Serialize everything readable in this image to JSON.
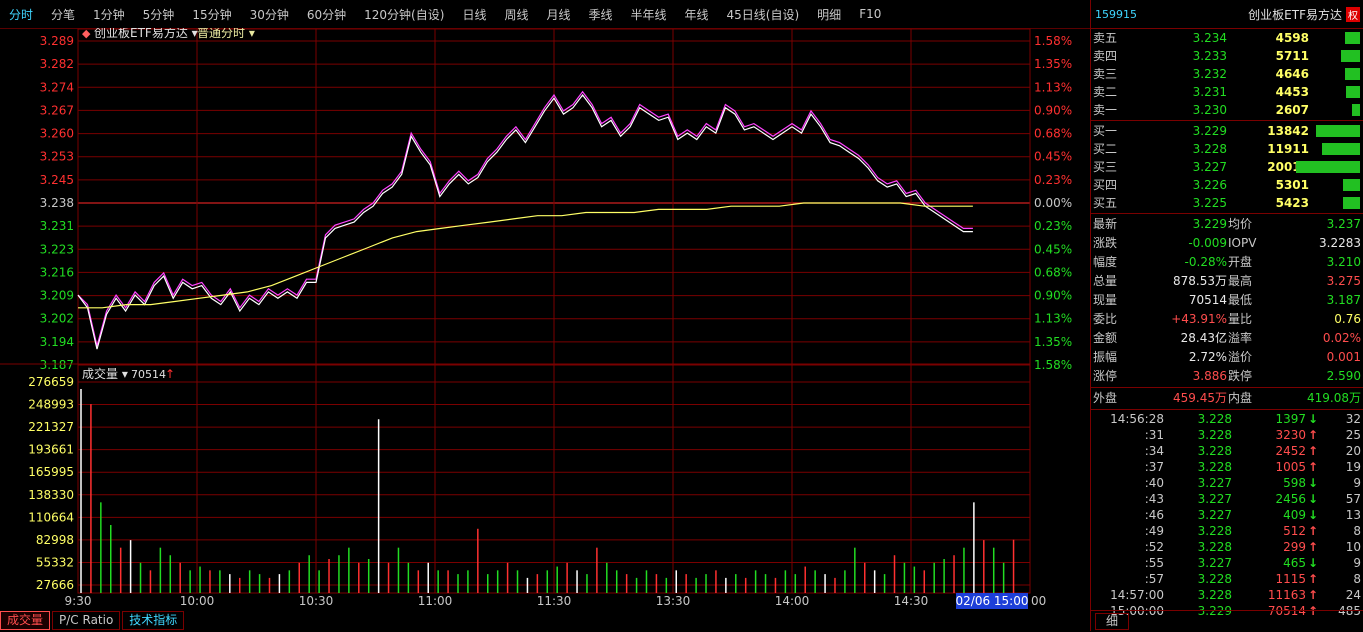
{
  "toolbar": {
    "tabs": [
      "分时",
      "分笔",
      "1分钟",
      "5分钟",
      "15分钟",
      "30分钟",
      "60分钟",
      "120分钟(自设)",
      "日线",
      "周线",
      "月线",
      "季线",
      "半年线",
      "年线",
      "45日线(自设)",
      "明细",
      "F10"
    ],
    "active_index": 0
  },
  "chart": {
    "stock_name": "创业板ETF易方达",
    "mode": "普通分时",
    "price_labels": [
      "3.289",
      "3.282",
      "3.274",
      "3.267",
      "3.260",
      "3.253",
      "3.245",
      "3.238",
      "3.231",
      "3.223",
      "3.216",
      "3.209",
      "3.202",
      "3.194",
      "3.187"
    ],
    "pct_labels": [
      "1.58%",
      "1.35%",
      "1.13%",
      "0.90%",
      "0.68%",
      "0.45%",
      "0.23%",
      "0.00%",
      "0.23%",
      "0.45%",
      "0.68%",
      "0.90%",
      "1.13%",
      "1.35%",
      "1.58%"
    ],
    "vol_title": "成交量",
    "vol_current": "70514",
    "vol_labels": [
      "276659",
      "248993",
      "221327",
      "193661",
      "165995",
      "138330",
      "110664",
      "82998",
      "55332",
      "27666"
    ],
    "time_labels": [
      "9:30",
      "10:00",
      "10:30",
      "11:00",
      "11:30",
      "13:30",
      "14:00",
      "14:30"
    ],
    "cursor_time": "02/06 15:00",
    "end_label": "00",
    "colors": {
      "price_line": "#ffffff",
      "etf_line": "#ff44ff",
      "avg_line": "#ffff66",
      "grid": "#7a0000",
      "up": "#ff3030",
      "down": "#22dd22"
    }
  },
  "chart_data": {
    "type": "line",
    "x_range": [
      "09:30",
      "15:00"
    ],
    "ylim": [
      3.187,
      3.289
    ],
    "prev_close": 3.238,
    "series": [
      {
        "values": [
          3.209,
          3.205,
          3.192,
          3.203,
          3.208,
          3.204,
          3.209,
          3.206,
          3.212,
          3.215,
          3.208,
          3.213,
          3.211,
          3.212,
          3.208,
          3.206,
          3.21,
          3.204,
          3.208,
          3.206,
          3.21,
          3.208,
          3.21,
          3.208,
          3.213,
          3.213,
          3.227,
          3.23,
          3.231,
          3.232,
          3.235,
          3.237,
          3.241,
          3.243,
          3.247,
          3.259,
          3.254,
          3.25,
          3.24,
          3.244,
          3.247,
          3.244,
          3.246,
          3.251,
          3.254,
          3.258,
          3.261,
          3.257,
          3.262,
          3.267,
          3.271,
          3.266,
          3.268,
          3.272,
          3.268,
          3.262,
          3.264,
          3.259,
          3.262,
          3.268,
          3.266,
          3.264,
          3.265,
          3.258,
          3.26,
          3.258,
          3.262,
          3.26,
          3.268,
          3.266,
          3.261,
          3.262,
          3.26,
          3.258,
          3.26,
          3.262,
          3.26,
          3.266,
          3.262,
          3.257,
          3.256,
          3.254,
          3.252,
          3.249,
          3.245,
          3.243,
          3.244,
          3.24,
          3.241,
          3.237,
          3.235,
          3.233,
          3.231,
          3.229,
          3.229
        ]
      },
      {
        "values": [
          3.209,
          3.206,
          3.193,
          3.204,
          3.209,
          3.205,
          3.21,
          3.207,
          3.213,
          3.216,
          3.209,
          3.214,
          3.212,
          3.213,
          3.209,
          3.207,
          3.211,
          3.205,
          3.209,
          3.207,
          3.211,
          3.209,
          3.211,
          3.209,
          3.214,
          3.214,
          3.228,
          3.231,
          3.232,
          3.233,
          3.236,
          3.238,
          3.242,
          3.244,
          3.248,
          3.26,
          3.255,
          3.251,
          3.241,
          3.245,
          3.248,
          3.245,
          3.247,
          3.252,
          3.255,
          3.259,
          3.262,
          3.258,
          3.263,
          3.268,
          3.272,
          3.267,
          3.269,
          3.273,
          3.269,
          3.263,
          3.265,
          3.26,
          3.263,
          3.269,
          3.267,
          3.265,
          3.266,
          3.259,
          3.261,
          3.259,
          3.263,
          3.261,
          3.269,
          3.267,
          3.262,
          3.263,
          3.261,
          3.259,
          3.261,
          3.263,
          3.261,
          3.267,
          3.263,
          3.258,
          3.257,
          3.255,
          3.253,
          3.25,
          3.246,
          3.244,
          3.245,
          3.241,
          3.242,
          3.238,
          3.236,
          3.234,
          3.232,
          3.23,
          3.23
        ]
      },
      {
        "values": [
          3.205,
          3.205,
          3.206,
          3.206,
          3.207,
          3.208,
          3.209,
          3.21,
          3.212,
          3.215,
          3.218,
          3.221,
          3.224,
          3.227,
          3.229,
          3.23,
          3.231,
          3.232,
          3.233,
          3.234,
          3.234,
          3.235,
          3.235,
          3.235,
          3.236,
          3.236,
          3.236,
          3.237,
          3.237,
          3.237,
          3.238,
          3.238,
          3.238,
          3.238,
          3.238,
          3.237,
          3.237,
          3.237
        ]
      }
    ],
    "volume": [
      270000,
      250000,
      120000,
      90000,
      60000,
      70000,
      40000,
      30000,
      60000,
      50000,
      40000,
      30000,
      35000,
      30000,
      30000,
      25000,
      20000,
      30000,
      25000,
      20000,
      25000,
      30000,
      40000,
      50000,
      30000,
      45000,
      50000,
      60000,
      40000,
      45000,
      230000,
      40000,
      60000,
      40000,
      30000,
      40000,
      30000,
      30000,
      25000,
      30000,
      85000,
      25000,
      30000,
      40000,
      30000,
      20000,
      25000,
      30000,
      35000,
      40000,
      30000,
      25000,
      60000,
      40000,
      30000,
      25000,
      20000,
      30000,
      25000,
      20000,
      30000,
      25000,
      20000,
      25000,
      30000,
      20000,
      25000,
      20000,
      30000,
      25000,
      20000,
      30000,
      25000,
      35000,
      30000,
      25000,
      20000,
      30000,
      60000,
      40000,
      30000,
      25000,
      50000,
      40000,
      35000,
      30000,
      40000,
      45000,
      50000,
      60000,
      120000,
      70000,
      60000,
      40000,
      70514
    ]
  },
  "panel": {
    "code": "159915",
    "name": "创业板ETF易方达",
    "quan": "权",
    "asks": [
      {
        "label": "卖五",
        "price": "3.234",
        "vol": "4598",
        "bar": 0.23
      },
      {
        "label": "卖四",
        "price": "3.233",
        "vol": "5711",
        "bar": 0.29
      },
      {
        "label": "卖三",
        "price": "3.232",
        "vol": "4646",
        "bar": 0.23
      },
      {
        "label": "卖二",
        "price": "3.231",
        "vol": "4453",
        "bar": 0.22
      },
      {
        "label": "卖一",
        "price": "3.230",
        "vol": "2607",
        "bar": 0.13
      }
    ],
    "bids": [
      {
        "label": "买一",
        "price": "3.229",
        "vol": "13842",
        "bar": 0.69
      },
      {
        "label": "买二",
        "price": "3.228",
        "vol": "11911",
        "bar": 0.6
      },
      {
        "label": "买三",
        "price": "3.227",
        "vol": "20011",
        "bar": 1.0
      },
      {
        "label": "买四",
        "price": "3.226",
        "vol": "5301",
        "bar": 0.26
      },
      {
        "label": "买五",
        "price": "3.225",
        "vol": "5423",
        "bar": 0.27
      }
    ],
    "stats": [
      {
        "l1": "最新",
        "v1": "3.229",
        "c1": "g",
        "l2": "均价",
        "v2": "3.237",
        "c2": "g"
      },
      {
        "l1": "涨跌",
        "v1": "-0.009",
        "c1": "g",
        "l2": "IOPV",
        "v2": "3.2283",
        "c2": "w"
      },
      {
        "l1": "幅度",
        "v1": "-0.28%",
        "c1": "g",
        "l2": "开盘",
        "v2": "3.210",
        "c2": "g"
      },
      {
        "l1": "总量",
        "v1": "878.53万",
        "c1": "w",
        "l2": "最高",
        "v2": "3.275",
        "c2": "r"
      },
      {
        "l1": "现量",
        "v1": "70514",
        "c1": "w",
        "l2": "最低",
        "v2": "3.187",
        "c2": "g"
      },
      {
        "l1": "委比",
        "v1": "+43.91%",
        "c1": "r",
        "l2": "量比",
        "v2": "0.76",
        "c2": "y"
      },
      {
        "l1": "金额",
        "v1": "28.43亿",
        "c1": "w",
        "l2": "溢率",
        "v2": "0.02%",
        "c2": "r"
      },
      {
        "l1": "振幅",
        "v1": "2.72%",
        "c1": "w",
        "l2": "溢价",
        "v2": "0.001",
        "c2": "r"
      },
      {
        "l1": "涨停",
        "v1": "3.886",
        "c1": "r",
        "l2": "跌停",
        "v2": "2.590",
        "c2": "g"
      }
    ],
    "outer_label": "外盘",
    "outer_value": "459.45万",
    "inner_label": "内盘",
    "inner_value": "419.08万",
    "ticks": [
      {
        "t": "14:56:28",
        "p": "3.228",
        "pc": "g",
        "v": "1397",
        "d": "down",
        "n": "32"
      },
      {
        "t": ":31",
        "p": "3.228",
        "pc": "g",
        "v": "3230",
        "d": "up",
        "n": "25"
      },
      {
        "t": ":34",
        "p": "3.228",
        "pc": "g",
        "v": "2452",
        "d": "up",
        "n": "20"
      },
      {
        "t": ":37",
        "p": "3.228",
        "pc": "g",
        "v": "1005",
        "d": "up",
        "n": "19"
      },
      {
        "t": ":40",
        "p": "3.227",
        "pc": "g",
        "v": "598",
        "d": "down",
        "n": "9"
      },
      {
        "t": ":43",
        "p": "3.227",
        "pc": "g",
        "v": "2456",
        "d": "down",
        "n": "57"
      },
      {
        "t": ":46",
        "p": "3.227",
        "pc": "g",
        "v": "409",
        "d": "down",
        "n": "13"
      },
      {
        "t": ":49",
        "p": "3.228",
        "pc": "g",
        "v": "512",
        "d": "up",
        "n": "8"
      },
      {
        "t": ":52",
        "p": "3.228",
        "pc": "g",
        "v": "299",
        "d": "up",
        "n": "10"
      },
      {
        "t": ":55",
        "p": "3.227",
        "pc": "g",
        "v": "465",
        "d": "down",
        "n": "9"
      },
      {
        "t": ":57",
        "p": "3.228",
        "pc": "g",
        "v": "1115",
        "d": "up",
        "n": "8"
      },
      {
        "t": "14:57:00",
        "p": "3.228",
        "pc": "g",
        "v": "11163",
        "d": "up",
        "n": "24"
      },
      {
        "t": "15:00:00",
        "p": "3.229",
        "pc": "g",
        "v": "70514",
        "d": "up",
        "n": "485"
      }
    ],
    "detail_label": "细"
  },
  "bottom_tabs": [
    "成交量",
    "P/C Ratio",
    "技术指标"
  ]
}
